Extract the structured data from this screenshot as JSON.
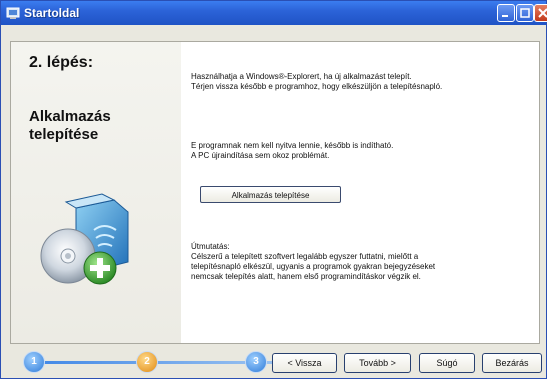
{
  "window": {
    "title": "Startoldal"
  },
  "left": {
    "step": "2. lépés:",
    "heading_line1": "Alkalmazás",
    "heading_line2": "telepítése"
  },
  "content": {
    "intro_line1": "Használhatja a Windows®-Explorert, ha új alkalmazást telepít.",
    "intro_line2": "Térjen vissza később e programhoz, hogy elkészüljön a telepítésnapló.",
    "note_line1": "E programnak nem kell nyitva lennie, később is indítható.",
    "note_line2": "A PC újraindítása sem okoz problémát.",
    "install_button": "Alkalmazás telepítése",
    "tip_title": "Útmutatás:",
    "tip_line1": "Célszerű a telepített szoftvert legalább egyszer futtatni, mielőtt a",
    "tip_line2": "telepítésnapló elkészül, ugyanis a programok gyakran bejegyzéseket",
    "tip_line3": "nemcsak telepítés alatt, hanem első programindításkor végzik el."
  },
  "wizard": {
    "steps": [
      "1",
      "2",
      "3"
    ],
    "back": "< Vissza",
    "next": "Tovább >",
    "help": "Súgó",
    "close": "Bezárás"
  }
}
